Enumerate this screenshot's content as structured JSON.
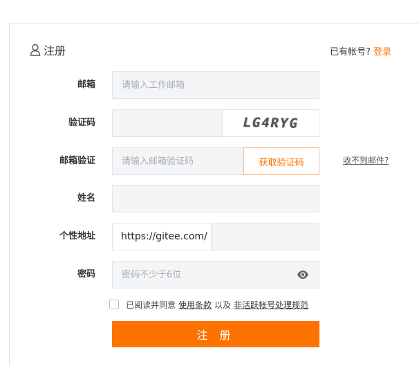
{
  "header": {
    "title": "注册",
    "login_hint": "已有帐号?",
    "login_link": "登录"
  },
  "form": {
    "email": {
      "label": "邮箱",
      "placeholder": "请输入工作邮箱",
      "value": ""
    },
    "captcha": {
      "label": "验证码",
      "value": "",
      "image_text": "LG4RYG"
    },
    "email_code": {
      "label": "邮箱验证",
      "placeholder": "请输入邮箱验证码",
      "button": "获取验证码",
      "help_link": "收不到邮件?"
    },
    "name": {
      "label": "姓名",
      "value": ""
    },
    "personal_url": {
      "label": "个性地址",
      "prefix": "https://gitee.com/",
      "value": ""
    },
    "password": {
      "label": "密码",
      "placeholder": "密码不少于6位",
      "value": ""
    },
    "agreement": {
      "text_before": "已阅读并同意",
      "terms_link": "使用条款",
      "conjunction": "以及",
      "policy_link": "非活跃帐号处理规范",
      "checked": false
    },
    "submit": "注 册"
  },
  "colors": {
    "accent": "#fe7300",
    "field_bg": "#f3f5f7",
    "border": "#e1e5ea"
  },
  "icons": {
    "title": "user-icon",
    "password_toggle": "eye-icon"
  }
}
